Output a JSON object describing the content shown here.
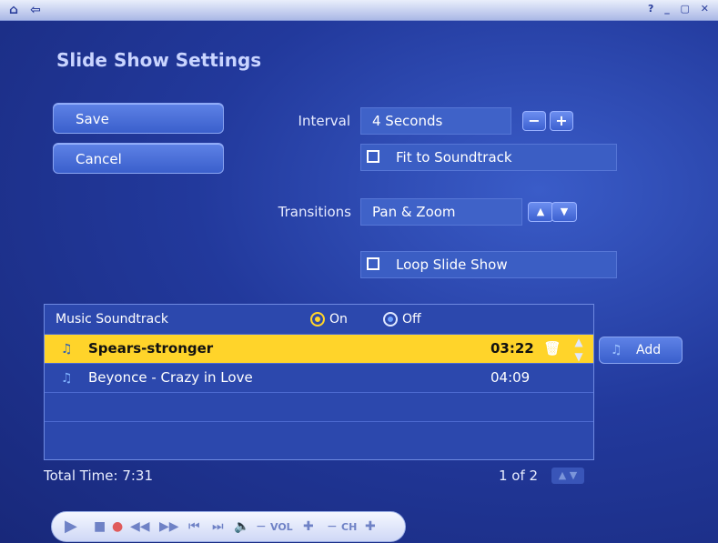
{
  "window": {
    "title": "Slide Show Settings"
  },
  "buttons": {
    "save": "Save",
    "cancel": "Cancel",
    "add": "Add"
  },
  "interval": {
    "label": "Interval",
    "value": "4 Seconds",
    "minus": "−",
    "plus": "+"
  },
  "fit_to_soundtrack": {
    "label": "Fit to Soundtrack",
    "checked": false
  },
  "transitions": {
    "label": "Transitions",
    "value": "Pan & Zoom"
  },
  "loop_slide_show": {
    "label": "Loop Slide Show",
    "checked": false
  },
  "music": {
    "heading": "Music Soundtrack",
    "on_label": "On",
    "off_label": "Off",
    "selected_option": "Off",
    "tracks": [
      {
        "name": "Spears-stronger",
        "duration": "03:22",
        "selected": true
      },
      {
        "name": "Beyonce - Crazy in Love",
        "duration": "04:09",
        "selected": false
      }
    ]
  },
  "footer": {
    "total_time": "Total Time: 7:31",
    "page_indicator": "1 of 2"
  },
  "transport": {
    "vol_label": "VOL",
    "ch_label": "CH"
  },
  "colors": {
    "background": "#22399c",
    "highlight": "#ffd42a"
  }
}
